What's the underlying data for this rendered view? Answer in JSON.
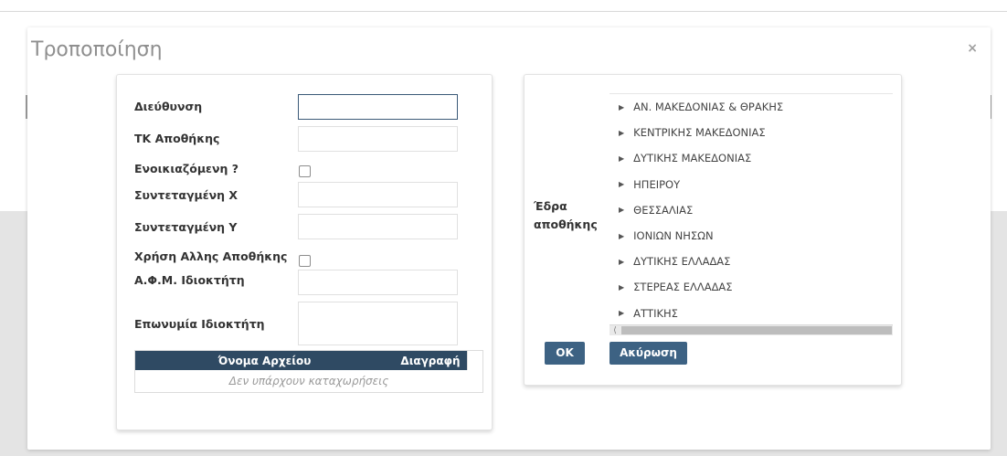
{
  "modal": {
    "title": "Τροποποίηση",
    "close_label": "×"
  },
  "form": {
    "fields": [
      {
        "label": "Διεύθυνση",
        "value": ""
      },
      {
        "label": "ΤΚ Αποθήκης",
        "value": ""
      },
      {
        "label": "Ενοικιαζόμενη ?",
        "checked": false
      },
      {
        "label": "Συντεταγμένη Χ",
        "value": ""
      },
      {
        "label": "Συντεταγμένη Υ",
        "value": ""
      },
      {
        "label": "Χρήση Αλλης Αποθήκης",
        "checked": false
      },
      {
        "label": "Α.Φ.Μ. Ιδιοκτήτη",
        "value": ""
      },
      {
        "label": "Επωνυμία Ιδιοκτήτη",
        "value": ""
      }
    ]
  },
  "files_table": {
    "columns": [
      "Όνομα Αρχείου",
      "Διαγραφή"
    ],
    "empty_text": "Δεν υπάρχουν καταχωρήσεις"
  },
  "region": {
    "label": "Έδρα αποθήκης",
    "items": [
      "ΑΝ. ΜΑΚΕΔΟΝΙΑΣ & ΘΡΑΚΗΣ",
      "ΚΕΝΤΡΙΚΗΣ ΜΑΚΕΔΟΝΙΑΣ",
      "ΔΥΤΙΚΗΣ ΜΑΚΕΔΟΝΙΑΣ",
      "ΗΠΕΙΡΟΥ",
      "ΘΕΣΣΑΛΙΑΣ",
      "ΙΟΝΙΩΝ ΝΗΣΩΝ",
      "ΔΥΤΙΚΗΣ ΕΛΛΑΔΑΣ",
      "ΣΤΕΡΕΑΣ ΕΛΛΑΔΑΣ",
      "ΑΤΤΙΚΗΣ"
    ],
    "expand_icon": "caret-right-icon",
    "scroll_left_icon": "chevron-left-icon"
  },
  "buttons": {
    "ok": "OK",
    "cancel": "Ακύρωση"
  },
  "colors": {
    "primary": "#3d6283",
    "table_header": "#2f4a63",
    "backdrop": "#e4e4e4"
  }
}
